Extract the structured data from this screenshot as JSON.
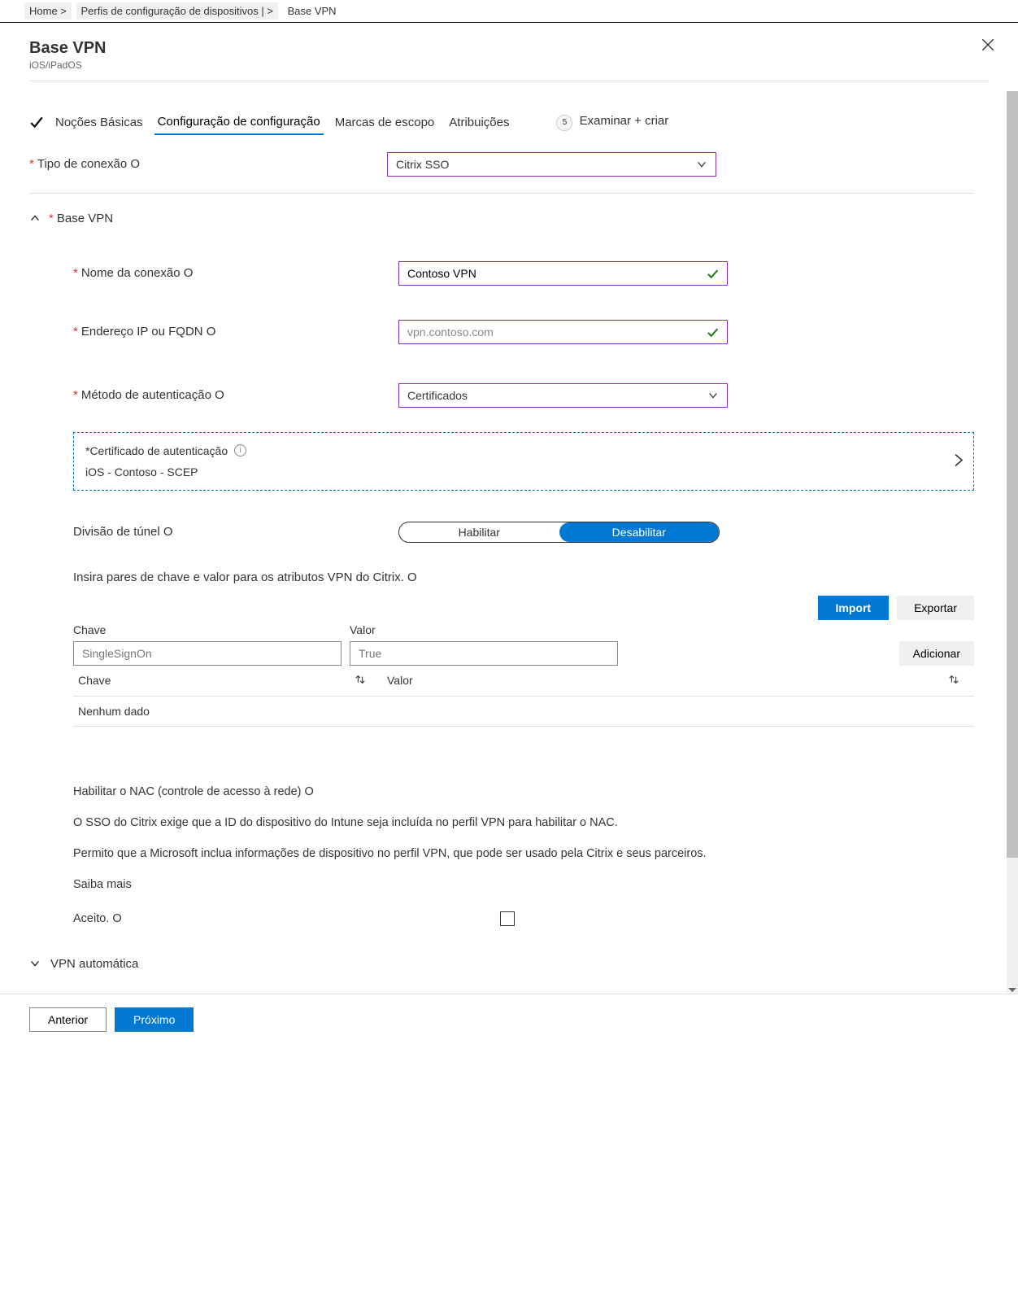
{
  "breadcrumb": {
    "items": [
      "Home >",
      "Perfis de configuração de dispositivos | >",
      "Base VPN"
    ]
  },
  "header": {
    "title": "Base VPN",
    "subtitle": "iOS/iPadOS"
  },
  "tabs": {
    "basics": "Noções Básicas",
    "config": "Configuração de configuração",
    "scope": "Marcas de escopo",
    "assign": "Atribuições",
    "review": "Examinar + criar",
    "step5": "5"
  },
  "fields": {
    "connection_type_label": "Tipo de conexão O",
    "connection_type_value": "Citrix SSO",
    "base_vpn_section": "Base VPN",
    "conn_name_label": "Nome da conexão O",
    "conn_name_value": "Contoso VPN",
    "ip_label": "Endereço IP ou FQDN O",
    "ip_value": "vpn.contoso.com",
    "auth_label": "Método de autenticação O",
    "auth_value": "Certificados",
    "cert_label": "*Certificado de autenticação",
    "cert_value": "iOS -  Contoso -    SCEP",
    "tunnel_label": "Divisão de túnel O",
    "tunnel_enable": "Habilitar",
    "tunnel_disable": "Desabilitar",
    "citrix_desc": "Insira pares de chave e valor para os atributos VPN do Citrix. O",
    "import_btn": "Import",
    "export_btn": "Exportar",
    "add_btn": "Adicionar",
    "key_label": "Chave",
    "val_label": "Valor",
    "key_placeholder": "SingleSignOn",
    "val_placeholder": "True",
    "th_key": "Chave",
    "th_val": "Valor",
    "no_data": "Nenhum dado",
    "nac_title": "Habilitar o NAC (controle de acesso à rede) O",
    "nac_p1": "O SSO do Citrix exige que a ID do dispositivo do Intune seja incluída no perfil VPN para habilitar o NAC.",
    "nac_p2": "Permito que a Microsoft inclua informações de dispositivo no perfil VPN, que pode ser usado pela Citrix e seus parceiros.",
    "nac_learn": "Saiba mais",
    "nac_accept": "Aceito. O",
    "auto_vpn": "VPN automática"
  },
  "footer": {
    "prev": "Anterior",
    "next": "Próximo"
  }
}
